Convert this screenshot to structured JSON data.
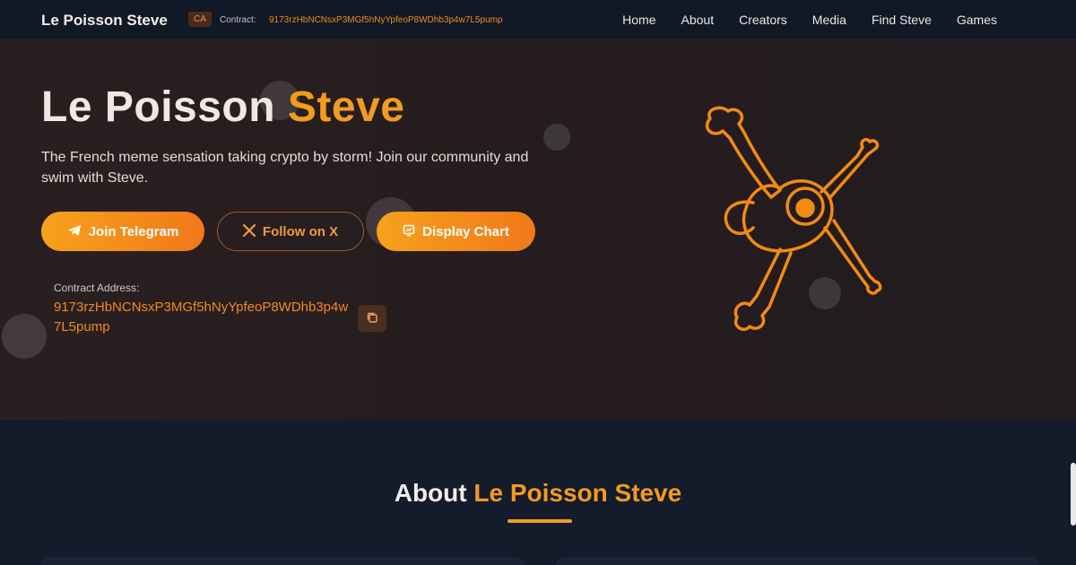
{
  "nav": {
    "brand": "Le Poisson Steve",
    "ca_badge": "CA",
    "contract_label": "Contract:",
    "contract_address": "9173rzHbNCNsxP3MGf5hNyYpfeoP8WDhb3p4w7L5pump",
    "links": [
      "Home",
      "About",
      "Creators",
      "Media",
      "Find Steve",
      "Games"
    ]
  },
  "hero": {
    "title_main": "Le Poisson ",
    "title_accent": "Steve",
    "subtitle": "The French meme sensation taking crypto by storm! Join our community and swim with Steve.",
    "buttons": {
      "telegram": "Join Telegram",
      "x": "Follow on X",
      "chart": "Display Chart"
    },
    "contract_label": "Contract Address:",
    "contract_address": "9173rzHbNCNsxP3MGf5hNyYpfeoP8WDhb3p4w7L5pump"
  },
  "about": {
    "title_main": "About ",
    "title_accent": "Le Poisson Steve"
  },
  "colors": {
    "accent": "#f39b1d",
    "nav_bg": "#111826",
    "hero_bg": "#2a1f20",
    "page_bg": "#141b2b"
  },
  "icons": {
    "telegram": "telegram-icon",
    "x": "x-logo-icon",
    "chart": "chart-icon",
    "copy": "copy-icon",
    "mascot": "fish-bones-mascot-icon"
  }
}
